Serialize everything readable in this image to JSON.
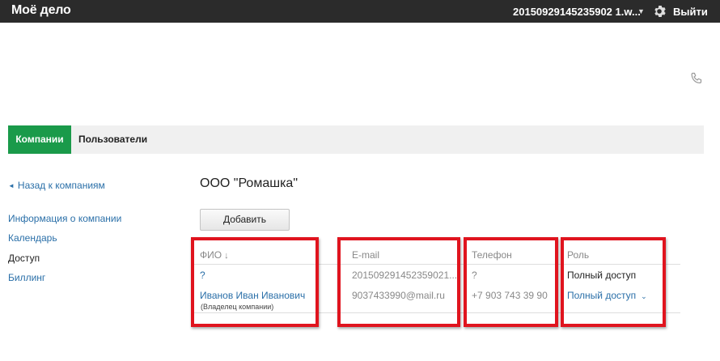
{
  "header": {
    "logo": "Моё дело",
    "account": "20150929145235902 1.w...",
    "logout": "Выйти"
  },
  "tabs": {
    "companies": "Компании",
    "users": "Пользователи"
  },
  "sidebar": {
    "back": "Назад к компаниям",
    "items": [
      {
        "label": "Информация о компании"
      },
      {
        "label": "Календарь"
      },
      {
        "label": "Доступ"
      },
      {
        "label": "Биллинг"
      }
    ]
  },
  "main": {
    "company_title": "ООО \"Ромашка\"",
    "add_button": "Добавить",
    "table": {
      "headers": {
        "fio": "ФИО",
        "sort_indicator": "↓",
        "email": "E-mail",
        "phone": "Телефон",
        "role": "Роль"
      },
      "rows": [
        {
          "fio": "?",
          "email": "201509291452359021...",
          "phone": "?",
          "role": "Полный доступ"
        },
        {
          "fio": "Иванов Иван Иванович",
          "note": "(Владелец компании)",
          "email": "9037433990@mail.ru",
          "phone": "+7 903 743 39 90",
          "role": "Полный доступ"
        }
      ]
    }
  },
  "colors": {
    "topbar": "#2b2b2b",
    "active_tab": "#1a9a4a",
    "link": "#2a6fa8",
    "highlight": "#e0141e"
  }
}
